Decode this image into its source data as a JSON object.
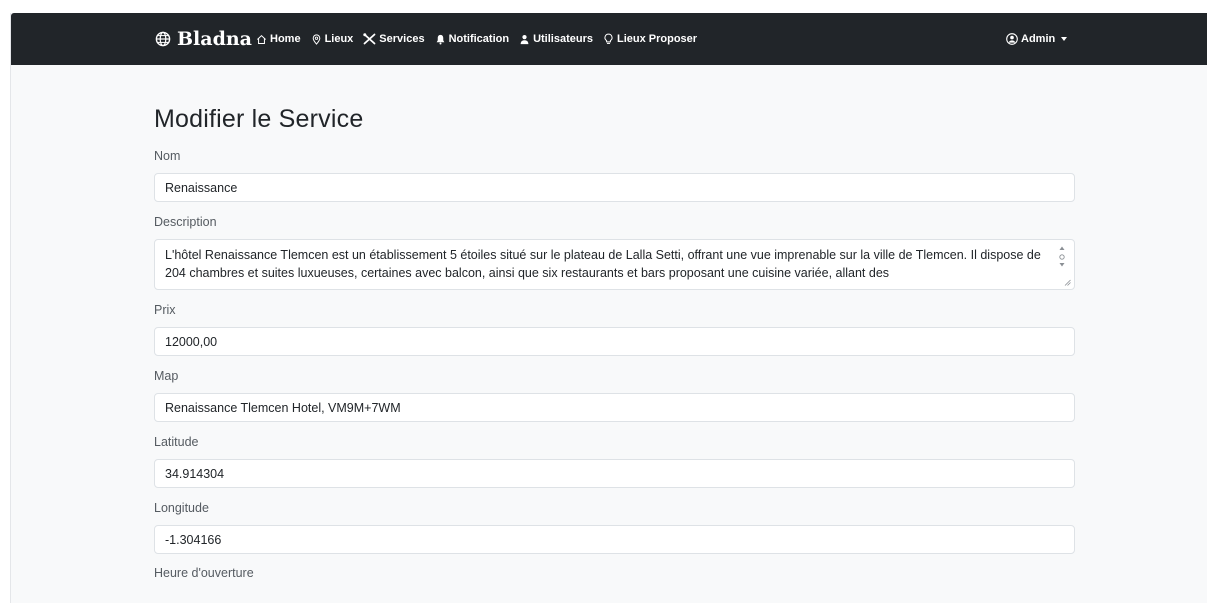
{
  "navbar": {
    "brand": "Bladna",
    "links": [
      {
        "label": "Home",
        "icon": "home-icon"
      },
      {
        "label": "Lieux",
        "icon": "map-pin-icon"
      },
      {
        "label": "Services",
        "icon": "tools-icon"
      },
      {
        "label": "Notification",
        "icon": "bell-icon"
      },
      {
        "label": "Utilisateurs",
        "icon": "person-icon"
      },
      {
        "label": "Lieux Proposer",
        "icon": "lightbulb-icon"
      }
    ],
    "user": "Admin",
    "user_icon": "user-circle-icon"
  },
  "form": {
    "title": "Modifier le Service",
    "nom_label": "Nom",
    "nom_value": "Renaissance",
    "description_label": "Description",
    "description_value": "L'hôtel Renaissance Tlemcen est un établissement 5 étoiles situé sur le plateau de Lalla Setti, offrant une vue imprenable sur la ville de Tlemcen. Il dispose de 204 chambres et suites luxueuses, certaines avec balcon, ainsi que six restaurants et bars proposant une cuisine variée, allant des",
    "prix_label": "Prix",
    "prix_value": "12000,00",
    "map_label": "Map",
    "map_value": "Renaissance Tlemcen Hotel, VM9M+7WM",
    "latitude_label": "Latitude",
    "latitude_value": "34.914304",
    "longitude_label": "Longitude",
    "longitude_value": "-1.304166",
    "heure_label": "Heure d'ouverture"
  },
  "colors": {
    "navbar_bg": "#212529",
    "page_bg": "#f8f9fa",
    "input_border": "#dee2e6"
  }
}
